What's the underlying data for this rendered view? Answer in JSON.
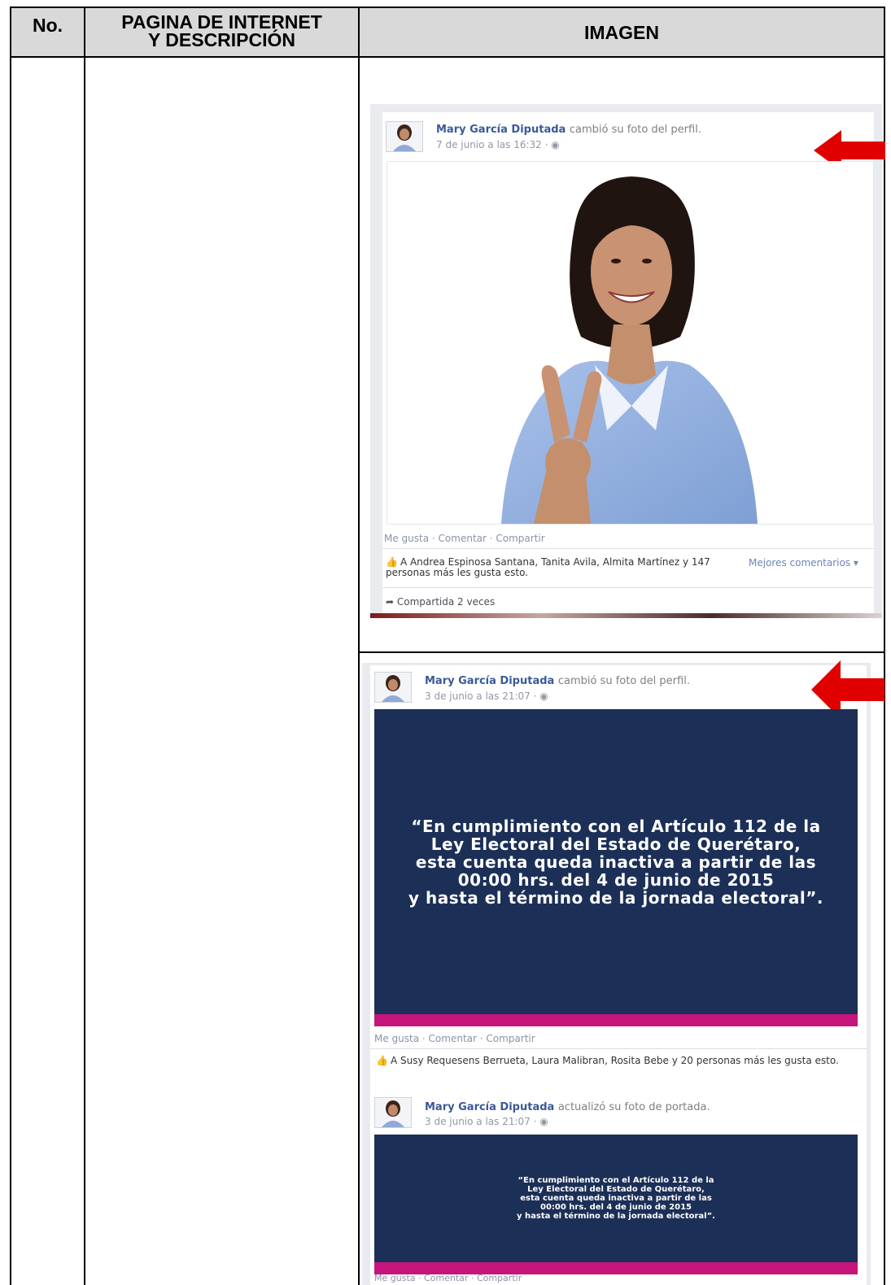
{
  "table": {
    "headers": {
      "no": "No.",
      "page": "PAGINA DE INTERNET\nY DESCRIPCIÓN",
      "image": "IMAGEN"
    }
  },
  "posts": [
    {
      "author": "Mary García Diputada",
      "action": "cambió su foto del perfil.",
      "time": "7 de junio a las 16:32 · ◉",
      "actions": [
        "Me gusta",
        "Comentar",
        "Compartir"
      ],
      "likes": "A Andrea Espinosa Santana, Tanita Avila, Almita Martínez y 147 personas más les gusta esto.",
      "best_comments": "Mejores comentarios ▾",
      "shared": "Compartida 2 veces"
    },
    {
      "author": "Mary García Diputada",
      "action": "cambió su foto del perfil.",
      "time": "3 de junio a las 21:07 · ◉",
      "image_text": "“En cumplimiento con el Artículo 112 de la\nLey Electoral del Estado de Querétaro,\nesta cuenta queda inactiva a partir de las\n00:00 hrs. del 4 de junio de 2015\ny hasta el término de la jornada electoral”.",
      "actions": [
        "Me gusta",
        "Comentar",
        "Compartir"
      ],
      "likes": "A Susy Requesens Berrueta, Laura Malibran, Rosita Bebe y 20 personas más les gusta esto."
    },
    {
      "author": "Mary García Diputada",
      "action": "actualizó su foto de portada.",
      "time": "3 de junio a las 21:07 · ◉",
      "image_text": "“En cumplimiento con el Artículo 112 de la\nLey Electoral del Estado de Querétaro,\nesta cuenta queda inactiva a partir de las\n00:00 hrs. del 4 de junio de 2015\ny hasta el término de la jornada electoral”.",
      "actions": [
        "Me gusta",
        "Comentar",
        "Compartir"
      ]
    }
  ],
  "colors": {
    "header_bg": "#d9d9d9",
    "fb_link": "#3b5998",
    "navy": "#1c2f57",
    "magenta": "#c5157a",
    "arrow": "#e00000"
  },
  "icons": [
    "arrow-left-icon",
    "thumbs-up-icon",
    "share-icon",
    "globe-icon",
    "avatar"
  ]
}
